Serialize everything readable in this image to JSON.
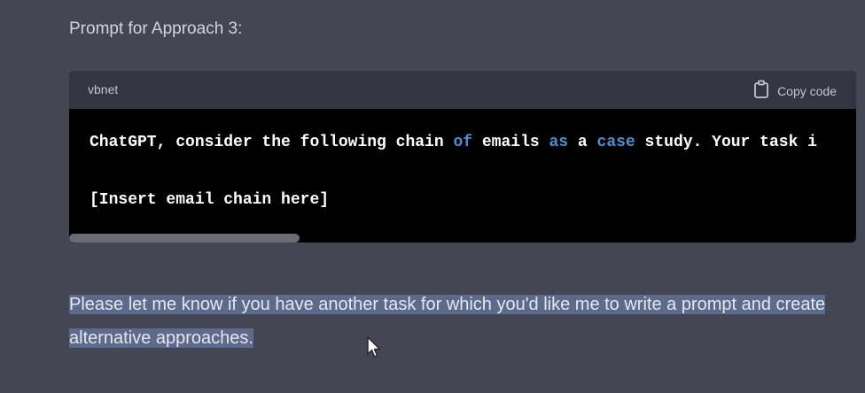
{
  "heading": "Prompt for Approach 3:",
  "code_block": {
    "language": "vbnet",
    "copy_label": "Copy code",
    "line1": {
      "t1": "ChatGPT, consider the following chain ",
      "kw1": "of",
      "t2": " emails ",
      "kw2": "as",
      "t3": " a ",
      "kw3": "case",
      "t4": " study. Your task i"
    },
    "line2": "[Insert email chain here]"
  },
  "message": "Please let me know if you have another task for which you'd like me to write a prompt and create alternative approaches.",
  "colors": {
    "background": "#444654",
    "code_background": "#000000",
    "keyword": "#4a8fd1",
    "selection": "#5c6b8c"
  }
}
